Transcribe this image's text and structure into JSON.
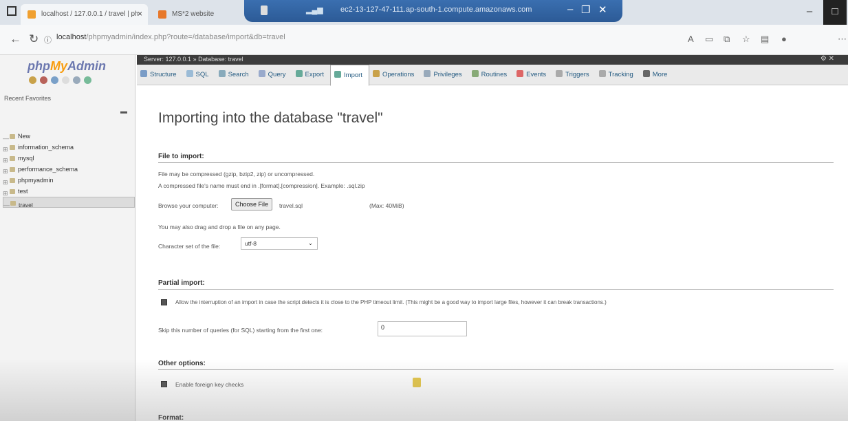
{
  "browser": {
    "tab1_title": "localhost / 127.0.0.1 / travel | ph",
    "tab2_title": "MS*2 website",
    "rdp_host": "ec2-13-127-47-111.ap-south-1.compute.amazonaws.com",
    "url_host": "localhost",
    "url_path": "/phpmyadmin/index.php?route=/database/import&db=travel"
  },
  "sidebar": {
    "logo_php": "php",
    "logo_my": "My",
    "logo_admin": "Admin",
    "recent_favorites": "Recent  Favorites",
    "items": [
      {
        "label": "New"
      },
      {
        "label": "information_schema"
      },
      {
        "label": "mysql"
      },
      {
        "label": "performance_schema"
      },
      {
        "label": "phpmyadmin"
      },
      {
        "label": "test"
      },
      {
        "label": "travel"
      }
    ]
  },
  "breadcrumb": {
    "server": "Server: 127.0.0.1",
    "database": "Database: travel"
  },
  "tabs": [
    {
      "label": "Structure",
      "color": "#7a9cc6"
    },
    {
      "label": "SQL",
      "color": "#9bbbd6"
    },
    {
      "label": "Search",
      "color": "#8ab"
    },
    {
      "label": "Query",
      "color": "#9ac"
    },
    {
      "label": "Export",
      "color": "#6a9"
    },
    {
      "label": "Import",
      "color": "#6a9"
    },
    {
      "label": "Operations",
      "color": "#c9a24a"
    },
    {
      "label": "Privileges",
      "color": "#9ab"
    },
    {
      "label": "Routines",
      "color": "#8a7"
    },
    {
      "label": "Events",
      "color": "#d66"
    },
    {
      "label": "Triggers",
      "color": "#aaa"
    },
    {
      "label": "Tracking",
      "color": "#aaa"
    },
    {
      "label": "More",
      "color": "#666"
    }
  ],
  "page": {
    "title": "Importing into the database \"travel\"",
    "file_section": "File to import:",
    "compress_note": "File may be compressed (gzip, bzip2, zip) or uncompressed.",
    "name_note": "A compressed file's name must end in .[format].[compression]. Example: .sql.zip",
    "browse_label": "Browse your computer:",
    "choose_file": "Choose File",
    "file_name": "travel.sql",
    "max_size": "(Max: 40MiB)",
    "drag_note": "You may also drag and drop a file on any page.",
    "charset_label": "Character set of the file:",
    "charset_value": "utf-8",
    "partial_section": "Partial import:",
    "allow_interrupt": "Allow the interruption of an import in case the script detects it is close to the PHP timeout limit. (This might be a good way to import large files, however it can break transactions.)",
    "skip_label": "Skip this number of queries (for SQL) starting from the first one:",
    "skip_value": "0",
    "other_section": "Other options:",
    "fk_checks": "Enable foreign key checks",
    "format_section": "Format:"
  }
}
